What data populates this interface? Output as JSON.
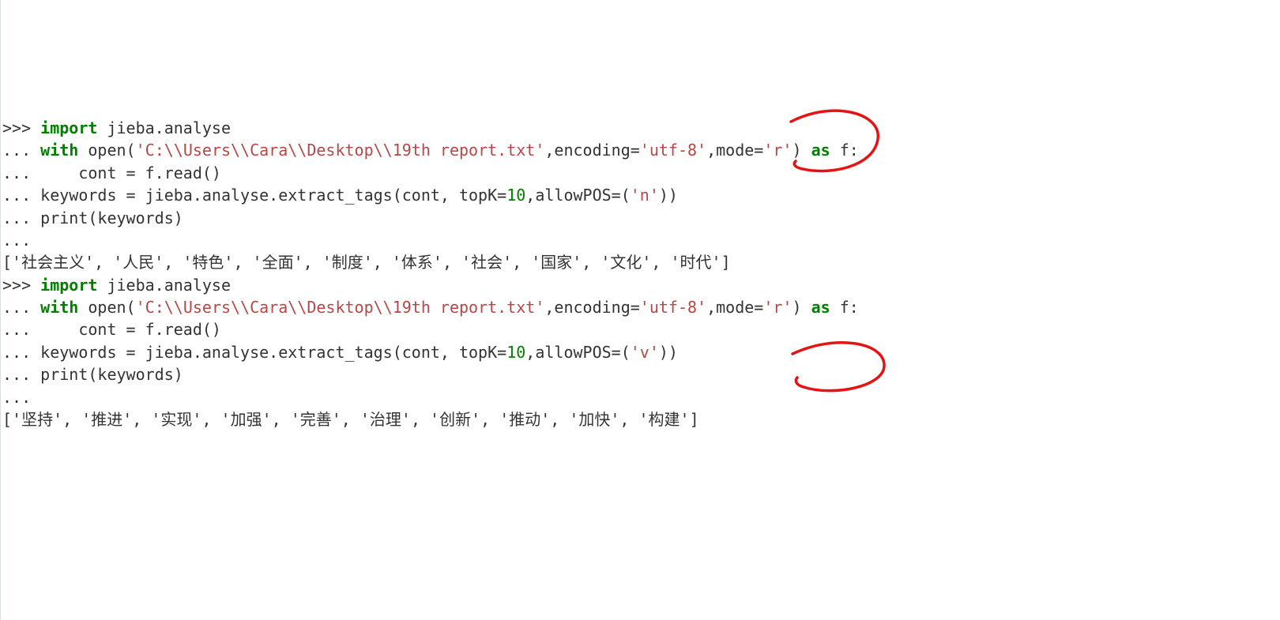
{
  "block1": {
    "prompt1": ">>> ",
    "kw_import": "import",
    "sp1": " ",
    "mod": "jieba.analyse",
    "prompt2": "... ",
    "kw_with": "with",
    "sp2": " ",
    "open_fn": "open(",
    "path_str": "'C:\\\\Users\\\\Cara\\\\Desktop\\\\19th report.txt'",
    "after_path": ",encoding=",
    "enc_str": "'utf-8'",
    "after_enc": ",mode=",
    "mode_str": "'r'",
    "after_mode": ") ",
    "kw_as": "as",
    "sp3": " f:",
    "prompt3": "... ",
    "indent": "    ",
    "cont_line": "cont = f.read()",
    "prompt4": "... ",
    "kw_line_prefix": "keywords = jieba.analyse.extract_tags(cont, topK=",
    "topk_num": "10",
    "after_topk": ",allowPOS=(",
    "pos_str": "'n'",
    "after_pos": "))",
    "prompt5": "... ",
    "print_line": "print(keywords)",
    "prompt6": "... ",
    "output": "['社会主义', '人民', '特色', '全面', '制度', '体系', '社会', '国家', '文化', '时代']"
  },
  "block2": {
    "prompt1": ">>> ",
    "kw_import": "import",
    "sp1": " ",
    "mod": "jieba.analyse",
    "prompt2": "... ",
    "kw_with": "with",
    "sp2": " ",
    "open_fn": "open(",
    "path_str": "'C:\\\\Users\\\\Cara\\\\Desktop\\\\19th report.txt'",
    "after_path": ",encoding=",
    "enc_str": "'utf-8'",
    "after_enc": ",mode=",
    "mode_str": "'r'",
    "after_mode": ") ",
    "kw_as": "as",
    "sp3": " f:",
    "prompt3": "... ",
    "indent": "    ",
    "cont_line": "cont = f.read()",
    "prompt4": "... ",
    "kw_line_prefix": "keywords = jieba.analyse.extract_tags(cont, topK=",
    "topk_num": "10",
    "after_topk": ",allowPOS=(",
    "pos_str": "'v'",
    "after_pos": "))",
    "prompt5": "... ",
    "print_line": "print(keywords)",
    "prompt6": "... ",
    "output": "['坚持', '推进', '实现', '加强', '完善', '治理', '创新', '推动', '加快', '构建']"
  }
}
